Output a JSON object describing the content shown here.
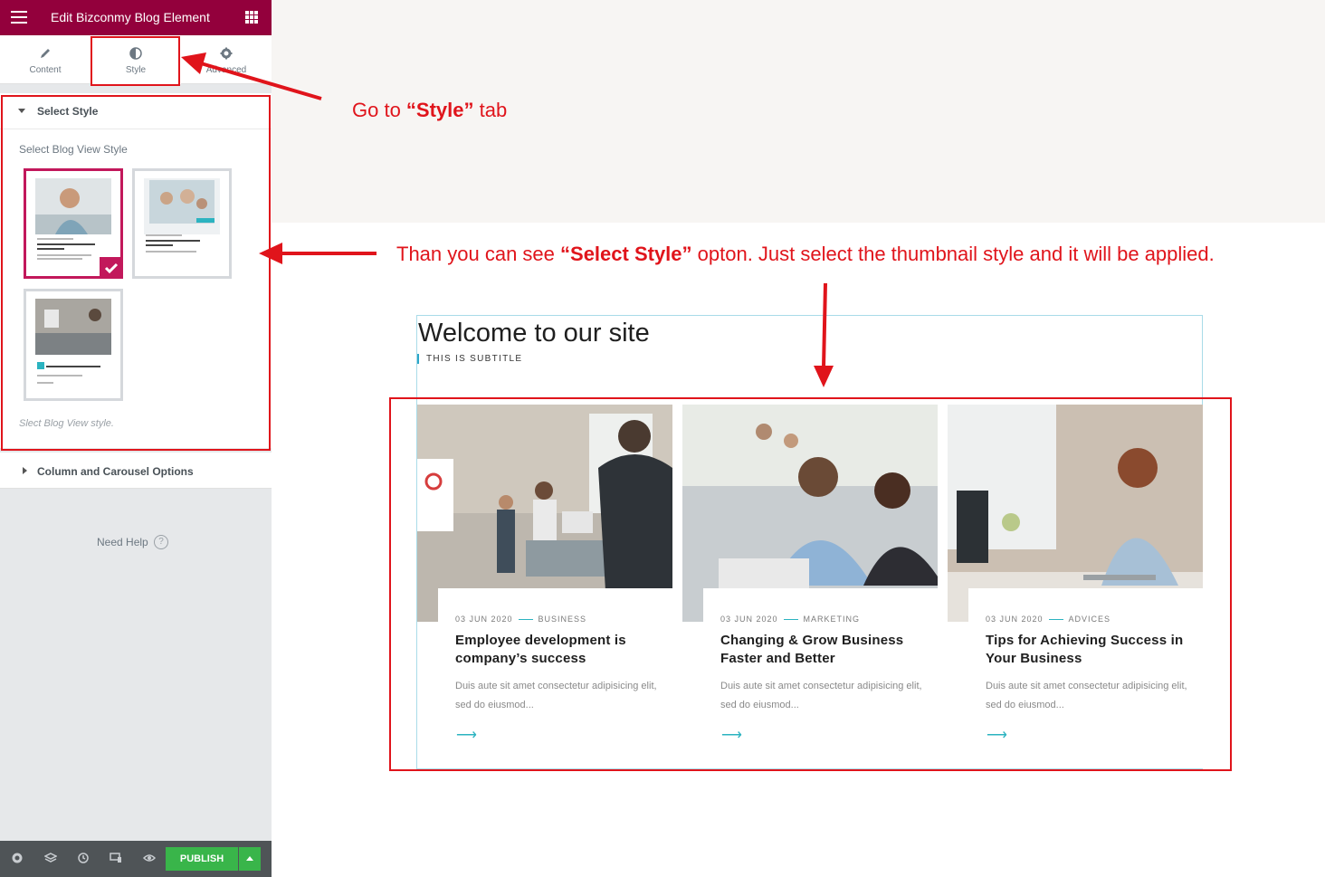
{
  "editor": {
    "title": "Edit Bizconmy Blog Element",
    "tabs": [
      {
        "label": "Content",
        "icon": "pencil-icon"
      },
      {
        "label": "Style",
        "icon": "contrast-icon"
      },
      {
        "label": "Advanced",
        "icon": "gear-icon"
      }
    ],
    "section_select_style": "Select Style",
    "select_label": "Select Blog View Style",
    "select_note": "Slect Blog View style.",
    "section_column": "Column and Carousel Options",
    "need_help": "Need Help",
    "help_glyph": "?",
    "publish": "PUBLISH"
  },
  "page": {
    "headline": "Welcome to our site",
    "subtitle": "THIS IS SUBTITLE",
    "posts": [
      {
        "date": "03 JUN 2020",
        "category": "BUSINESS",
        "title": "Employee development is company’s success",
        "excerpt": "Duis aute sit amet consectetur adipisicing elit, sed do eiusmod...",
        "arrow": "⟶"
      },
      {
        "date": "03 JUN 2020",
        "category": "MARKETING",
        "title": "Changing & Grow Business Faster and Better",
        "excerpt": "Duis aute sit amet consectetur adipisicing elit, sed do eiusmod...",
        "arrow": "⟶"
      },
      {
        "date": "03 JUN 2020",
        "category": "ADVICES",
        "title": "Tips for Achieving Success in Your Business",
        "excerpt": "Duis aute sit amet consectetur adipisicing elit, sed do eiusmod...",
        "arrow": "⟶"
      }
    ]
  },
  "annotations": {
    "go_pre": "Go  to ",
    "go_strong": "“Style”",
    "go_post": " tab",
    "than_pre": "Than you  can see ",
    "than_strong": "“Select Style”",
    "than_post": " opton. Just select the thumbnail style and it will be applied."
  },
  "colors": {
    "brand": "#93003c",
    "accent": "#c2185b",
    "publish": "#39b54a",
    "annotation": "#e0141b",
    "teal": "#2bb3c0"
  }
}
